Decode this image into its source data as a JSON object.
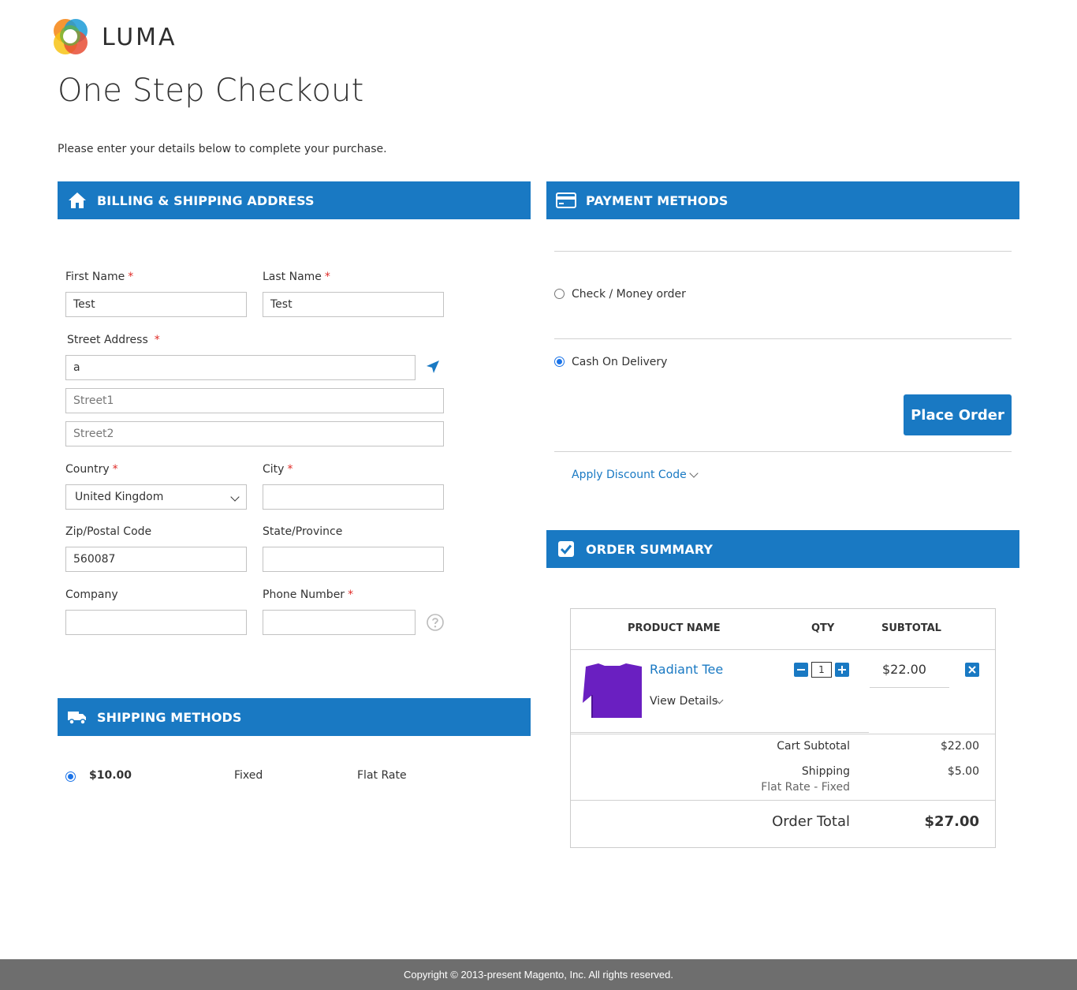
{
  "brand": {
    "name": "LUMA",
    "accent": "#1979c3"
  },
  "page": {
    "title": "One Step Checkout",
    "intro": "Please enter your details below to complete your purchase."
  },
  "billing": {
    "header": "BILLING & SHIPPING ADDRESS",
    "header_icon": "home-icon",
    "first_name": {
      "label": "First Name",
      "value": "Test"
    },
    "last_name": {
      "label": "Last Name",
      "value": "Test"
    },
    "street": {
      "label": "Street Address",
      "line1": "a",
      "line2_placeholder": "Street1",
      "line3_placeholder": "Street2"
    },
    "country": {
      "label": "Country",
      "value": "United Kingdom"
    },
    "city": {
      "label": "City",
      "value": ""
    },
    "zip": {
      "label": "Zip/Postal Code",
      "value": "560087"
    },
    "state": {
      "label": "State/Province",
      "value": ""
    },
    "company": {
      "label": "Company",
      "value": ""
    },
    "phone": {
      "label": "Phone Number",
      "value": ""
    },
    "required_mark": "*"
  },
  "shipping": {
    "header": "SHIPPING METHODS",
    "header_icon": "truck-icon",
    "method": {
      "price": "$10.00",
      "type": "Fixed",
      "carrier": "Flat Rate",
      "selected": true
    }
  },
  "payment": {
    "header": "PAYMENT METHODS",
    "header_icon": "credit-card-icon",
    "options": [
      {
        "label": "Check / Money order",
        "selected": false
      },
      {
        "label": "Cash On Delivery",
        "selected": true
      }
    ],
    "place_order_label": "Place Order",
    "discount_label": "Apply Discount Code"
  },
  "summary": {
    "header": "ORDER SUMMARY",
    "header_icon": "checkbox-icon",
    "columns": {
      "product": "PRODUCT NAME",
      "qty": "QTY",
      "subtotal": "SUBTOTAL"
    },
    "item": {
      "name": "Radiant Tee",
      "details_label": "View Details",
      "qty": "1",
      "subtotal": "$22.00",
      "image_color": "#6a1fc1"
    },
    "cart_subtotal_label": "Cart Subtotal",
    "cart_subtotal": "$22.00",
    "shipping_label": "Shipping",
    "shipping_method": "Flat Rate - Fixed",
    "shipping_value": "$5.00",
    "order_total_label": "Order Total",
    "order_total": "$27.00"
  },
  "footer": {
    "copyright": "Copyright © 2013-present Magento, Inc. All rights reserved."
  }
}
